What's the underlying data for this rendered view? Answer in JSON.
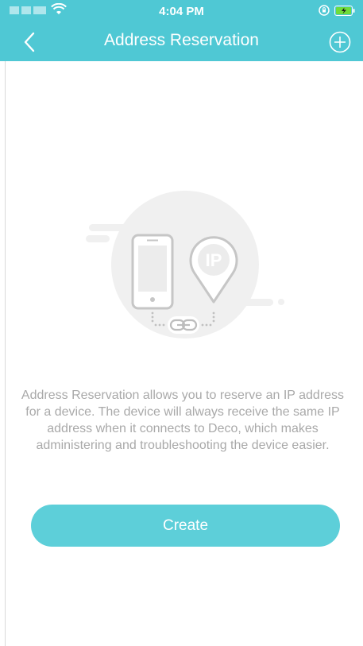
{
  "status_bar": {
    "time": "4:04 PM"
  },
  "nav": {
    "title": "Address Reservation",
    "back_icon": "chevron-left-icon",
    "add_icon": "plus-circle-icon"
  },
  "illustration": {
    "badge_text": "IP"
  },
  "description": "Address Reservation allows you to reserve an IP address for a device. The device will always receive the same IP address when it connects to Deco, which makes administering and troubleshooting the device easier.",
  "create_button": {
    "label": "Create"
  },
  "colors": {
    "header": "#4fc8d4",
    "button": "#5dcfd9",
    "text_muted": "#a9a9a9"
  }
}
